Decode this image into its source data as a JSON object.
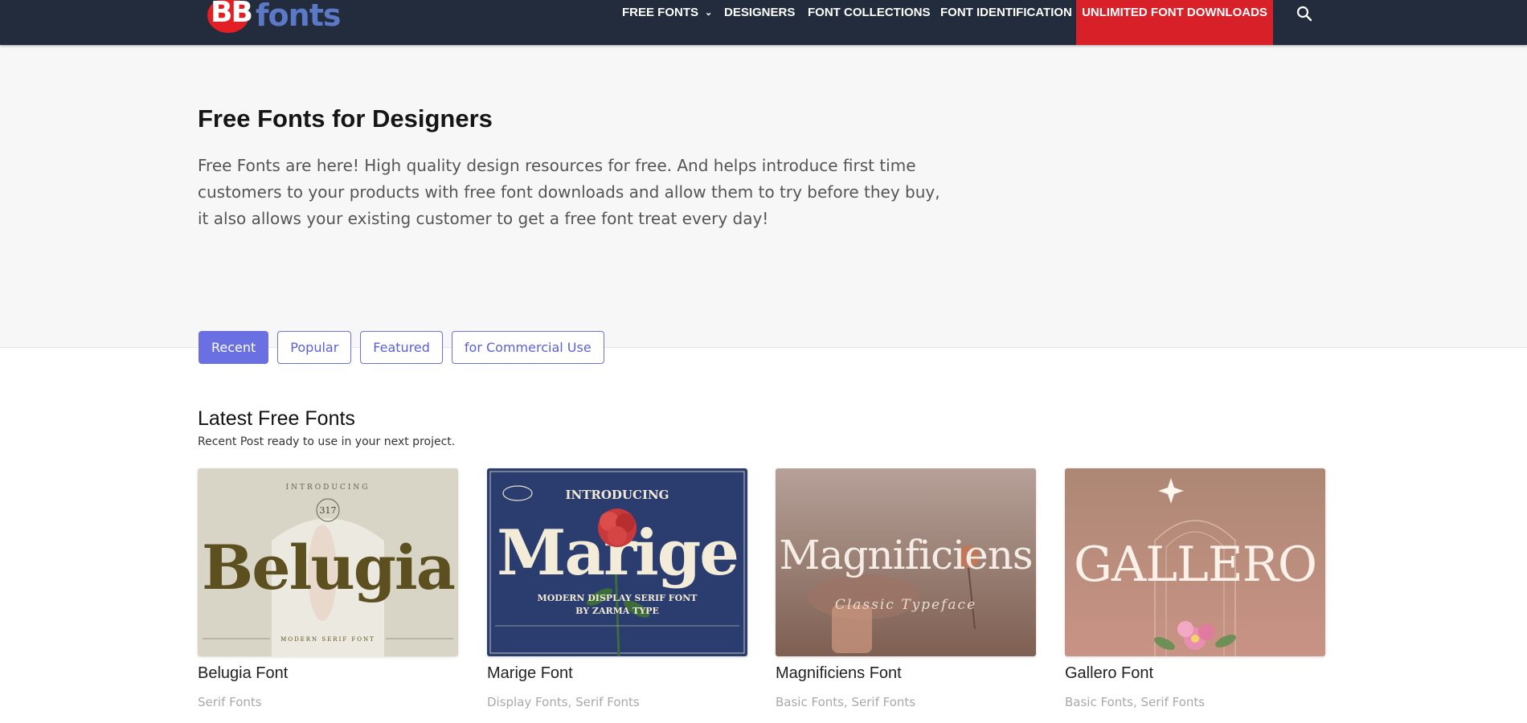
{
  "header": {
    "logo_text": "BBfonts",
    "nav": {
      "free_fonts": "FREE FONTS",
      "designers": "DESIGNERS",
      "font_collections": "FONT COLLECTIONS",
      "font_identification": "FONT IDENTIFICATION",
      "unlimited": "UNLIMITED FONT DOWNLOADS"
    },
    "colors": {
      "bar": "#222c3c",
      "cta": "#d72027",
      "logo_red": "#e31e24",
      "logo_blue": "#5b79c7"
    }
  },
  "hero": {
    "title": "Free Fonts for Designers",
    "description": "Free Fonts are here! High quality design resources for free. And helps introduce first time customers to your products with free font downloads and allow them to try before they buy, it also allows your existing customer to get a free font treat every day!"
  },
  "tabs": {
    "recent": "Recent",
    "popular": "Popular",
    "featured": "Featured",
    "commercial": "for Commercial Use",
    "active": "Recent",
    "accent": "#6a70e2"
  },
  "section": {
    "title": "Latest Free Fonts",
    "subtitle": "Recent Post ready to use in your next project."
  },
  "fonts": [
    {
      "title": "Belugia Font",
      "categories": [
        "Serif Fonts"
      ],
      "thumb": {
        "word": "Belugia",
        "top": "INTRODUCING",
        "badge": "317",
        "bottom": "MODERN SERIF FONT"
      }
    },
    {
      "title": "Marige Font",
      "categories": [
        "Display Fonts",
        "Serif Fonts"
      ],
      "thumb": {
        "word": "Marige",
        "top": "INTRODUCING",
        "line1": "MODERN DISPLAY SERIF FONT",
        "line2": "BY ZARMA TYPE"
      }
    },
    {
      "title": "Magnificiens Font",
      "categories": [
        "Basic Fonts",
        "Serif Fonts"
      ],
      "thumb": {
        "word": "Magnificiens",
        "sub": "Classic Typeface"
      }
    },
    {
      "title": "Gallero Font",
      "categories": [
        "Basic Fonts",
        "Serif Fonts"
      ],
      "thumb": {
        "word": "GALLERO"
      }
    }
  ]
}
